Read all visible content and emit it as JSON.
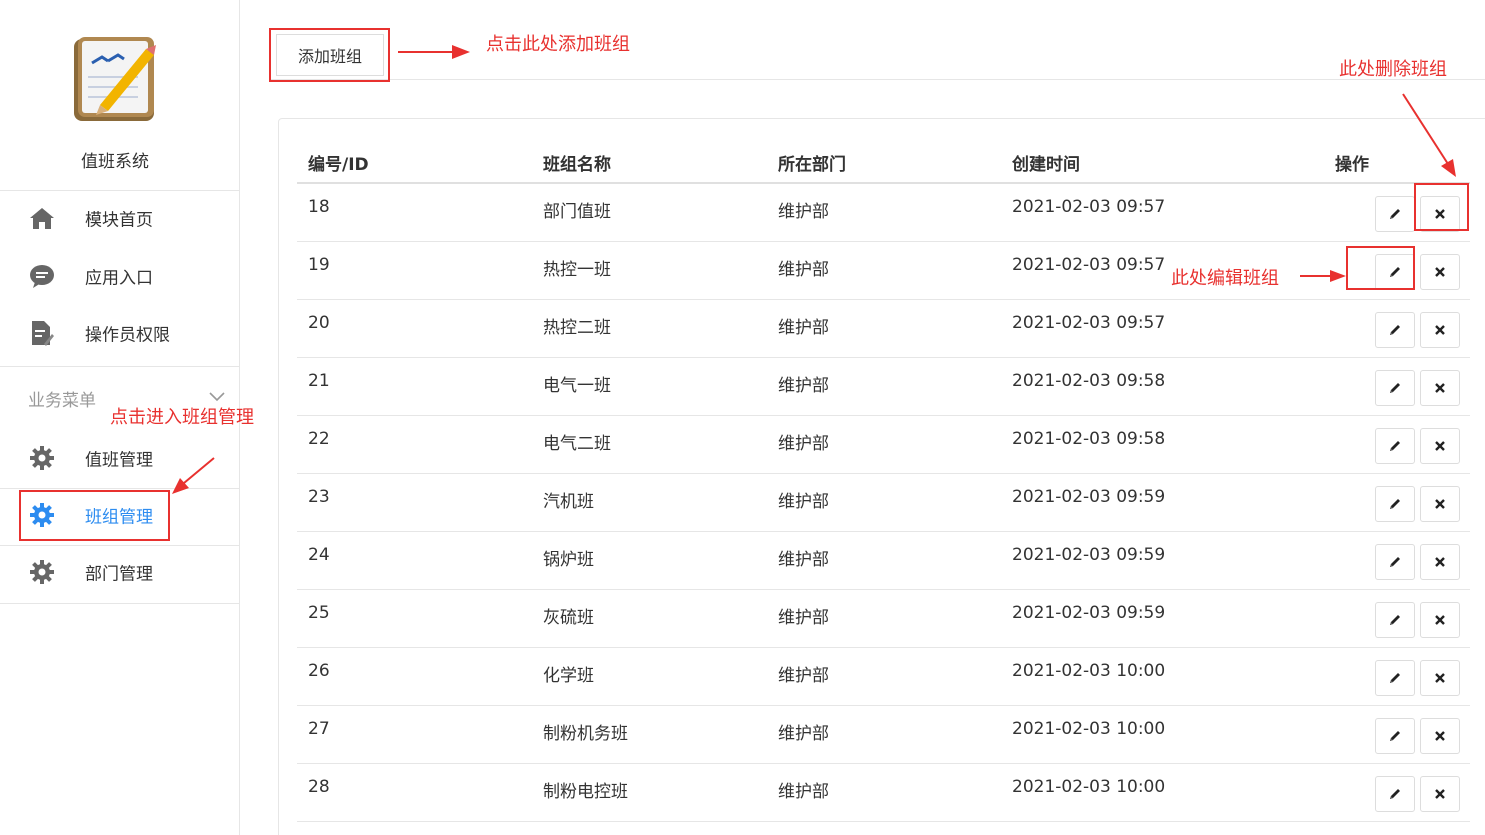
{
  "app": {
    "name": "值班系统"
  },
  "sidebar": {
    "items": [
      {
        "label": "模块首页",
        "icon": "home-icon"
      },
      {
        "label": "应用入口",
        "icon": "chat-icon"
      },
      {
        "label": "操作员权限",
        "icon": "document-edit-icon"
      }
    ],
    "group_label": "业务菜单",
    "group_items": [
      {
        "label": "值班管理",
        "icon": "gear-icon",
        "active": false
      },
      {
        "label": "班组管理",
        "icon": "gear-icon",
        "active": true
      },
      {
        "label": "部门管理",
        "icon": "gear-icon",
        "active": false
      }
    ]
  },
  "toolbar": {
    "add_label": "添加班组"
  },
  "table": {
    "headers": [
      "编号/ID",
      "班组名称",
      "所在部门",
      "创建时间",
      "操作"
    ],
    "rows": [
      [
        "18",
        "部门值班",
        "维护部",
        "2021-02-03 09:57"
      ],
      [
        "19",
        "热控一班",
        "维护部",
        "2021-02-03 09:57"
      ],
      [
        "20",
        "热控二班",
        "维护部",
        "2021-02-03 09:57"
      ],
      [
        "21",
        "电气一班",
        "维护部",
        "2021-02-03 09:58"
      ],
      [
        "22",
        "电气二班",
        "维护部",
        "2021-02-03 09:58"
      ],
      [
        "23",
        "汽机班",
        "维护部",
        "2021-02-03 09:59"
      ],
      [
        "24",
        "锅炉班",
        "维护部",
        "2021-02-03 09:59"
      ],
      [
        "25",
        "灰硫班",
        "维护部",
        "2021-02-03 09:59"
      ],
      [
        "26",
        "化学班",
        "维护部",
        "2021-02-03 10:00"
      ],
      [
        "27",
        "制粉机务班",
        "维护部",
        "2021-02-03 10:00"
      ],
      [
        "28",
        "制粉电控班",
        "维护部",
        "2021-02-03 10:00"
      ]
    ]
  },
  "annotations": {
    "add": "点击此处添加班组",
    "delete": "此处删除班组",
    "edit": "此处编辑班组",
    "enter": "点击进入班组管理"
  },
  "colors": {
    "accent": "#2d8cf0",
    "annotation": "#e8312f"
  }
}
